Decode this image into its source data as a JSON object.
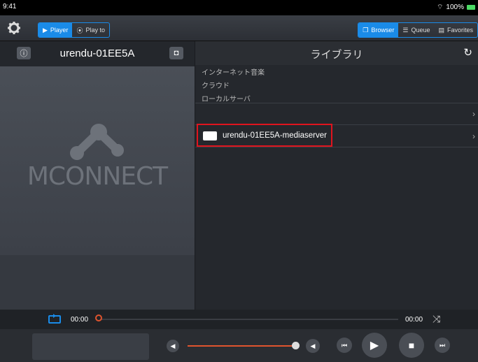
{
  "status": {
    "time": "9:41",
    "battery": "100%"
  },
  "toolbar": {
    "player_label": "Player",
    "playto_label": "Play to",
    "browser_label": "Browser",
    "queue_label": "Queue",
    "favorites_label": "Favorites"
  },
  "player": {
    "device_name": "urendu-01EE5A",
    "logo_text": "MCONNECT"
  },
  "library": {
    "title": "ライブラリ",
    "crumbs": [
      "インターネット音楽",
      "クラウド",
      "ローカルサーバ"
    ],
    "server_name": "urendu-01EE5A-mediaserver"
  },
  "transport": {
    "elapsed": "00:00",
    "remaining": "00:00",
    "progress": 0,
    "volume": 1.0
  },
  "colors": {
    "accent": "#1a8be8",
    "highlight": "#e0141e",
    "progress": "#e0542e"
  }
}
